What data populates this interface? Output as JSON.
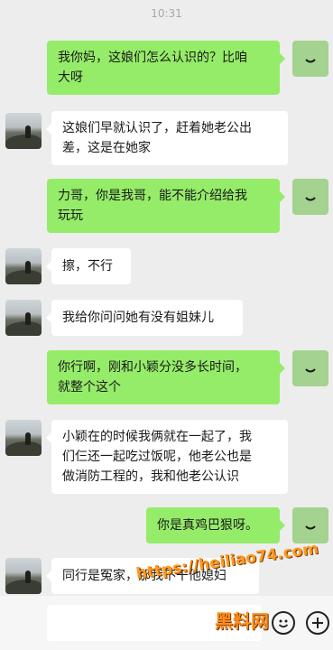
{
  "header": {
    "time": "10:31"
  },
  "messages": [
    {
      "side": "self",
      "text": "我你妈，这娘们怎么认识的？比咱\n大呀"
    },
    {
      "side": "other",
      "text": "这娘们早就认识了，赶着她老公出\n差，这是在她家"
    },
    {
      "side": "self",
      "text": "力哥，你是我哥，能不能介绍给我\n玩玩"
    },
    {
      "side": "other",
      "text": "擦，不行"
    },
    {
      "side": "other",
      "text": "我给你问问她有没有姐妹儿"
    },
    {
      "side": "self",
      "text": "你行啊，刚和小颖分没多长时间，\n就整个这个"
    },
    {
      "side": "other",
      "text": "小颖在的时候我俩就在一起了，我\n们仨还一起吃过饭呢，他老公也是\n做消防工程的，我和他老公认识"
    },
    {
      "side": "self",
      "text": "你是真鸡巴狠呀。"
    },
    {
      "side": "other",
      "text": "同行是冤家，那我不干他媳妇"
    }
  ],
  "watermark": {
    "url": "https://heiliao74.com",
    "name": "黑料网"
  },
  "toolbar": {
    "emoji_icon": "emoji-icon",
    "add_icon": "plus-circle-icon"
  },
  "colors": {
    "self_bubble": "#95ec69",
    "other_bubble": "#ffffff",
    "background": "#ededed"
  }
}
